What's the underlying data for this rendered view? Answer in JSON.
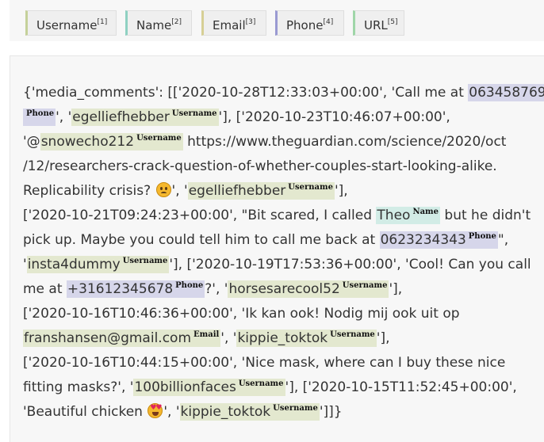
{
  "legend": [
    {
      "label": "Username",
      "sup": "[1]",
      "color": "#c5d19a"
    },
    {
      "label": "Name",
      "sup": "[2]",
      "color": "#8fd1c2"
    },
    {
      "label": "Email",
      "sup": "[3]",
      "color": "#d6cf95"
    },
    {
      "label": "Phone",
      "sup": "[4]",
      "color": "#9a9ad2"
    },
    {
      "label": "URL",
      "sup": "[5]",
      "color": "#9fd6a8"
    }
  ],
  "entity_labels": {
    "username": "Username",
    "name": "Name",
    "email": "Email",
    "phone": "Phone"
  },
  "emojis": {
    "worried": "worried-face-emoji",
    "hearts": "heart-eyes-emoji"
  },
  "lines": [
    {
      "segments": [
        {
          "text": "{'media_comments': [['2020-10-28T12:33:03+00:00', 'Call me at "
        },
        {
          "text": "063458769",
          "entity": "phone"
        }
      ]
    },
    {
      "segments": [
        {
          "text": "",
          "entity": "phone",
          "label_only": true
        },
        {
          "text": "', '"
        },
        {
          "text": "egelliefhebber",
          "entity": "username"
        },
        {
          "text": "'], ['2020-10-23T10:46:07+00:00',"
        }
      ]
    },
    {
      "segments": [
        {
          "text": "'@"
        },
        {
          "text": "snowecho212",
          "entity": "username"
        },
        {
          "text": " https://www.theguardian.com/science/2020/oct"
        }
      ]
    },
    {
      "segments": [
        {
          "text": "/12/researchers-crack-question-of-whether-couples-start-looking-alike."
        }
      ]
    },
    {
      "segments": [
        {
          "text": "Replicability crisis? "
        },
        {
          "emoji": "worried"
        },
        {
          "text": "', '"
        },
        {
          "text": "egelliefhebber",
          "entity": "username"
        },
        {
          "text": "'],"
        }
      ]
    },
    {
      "segments": [
        {
          "text": "['2020-10-21T09:24:23+00:00', \"Bit scared, I called "
        },
        {
          "text": "Theo",
          "entity": "name"
        },
        {
          "text": " but he didn't"
        }
      ]
    },
    {
      "segments": [
        {
          "text": "pick up. Maybe you could tell him to call me back at "
        },
        {
          "text": "0623234343",
          "entity": "phone"
        },
        {
          "text": "\","
        }
      ]
    },
    {
      "segments": [
        {
          "text": "'"
        },
        {
          "text": "insta4dummy",
          "entity": "username"
        },
        {
          "text": "'], ['2020-10-19T17:53:36+00:00', 'Cool! Can you call"
        }
      ]
    },
    {
      "segments": [
        {
          "text": "me at "
        },
        {
          "text": "+31612345678",
          "entity": "phone"
        },
        {
          "text": "?', '"
        },
        {
          "text": "horsesarecool52",
          "entity": "username"
        },
        {
          "text": "'],"
        }
      ]
    },
    {
      "segments": [
        {
          "text": "['2020-10-16T10:46:36+00:00', 'Ik kan ook! Nodig mij ook uit op"
        }
      ]
    },
    {
      "segments": [
        {
          "text": "franshansen@gmail.com",
          "entity": "email"
        },
        {
          "text": "', '"
        },
        {
          "text": "kippie_toktok",
          "entity": "username"
        },
        {
          "text": "'],"
        }
      ]
    },
    {
      "segments": [
        {
          "text": "['2020-10-16T10:44:15+00:00', 'Nice mask, where can I buy these nice"
        }
      ]
    },
    {
      "segments": [
        {
          "text": "fitting masks?', '"
        },
        {
          "text": "100billionfaces",
          "entity": "username"
        },
        {
          "text": "'], ['2020-10-15T11:52:45+00:00',"
        }
      ]
    },
    {
      "segments": [
        {
          "text": "'Beautiful chicken "
        },
        {
          "emoji": "hearts"
        },
        {
          "text": "', '"
        },
        {
          "text": "kippie_toktok",
          "entity": "username"
        },
        {
          "text": "']]}"
        }
      ]
    }
  ]
}
